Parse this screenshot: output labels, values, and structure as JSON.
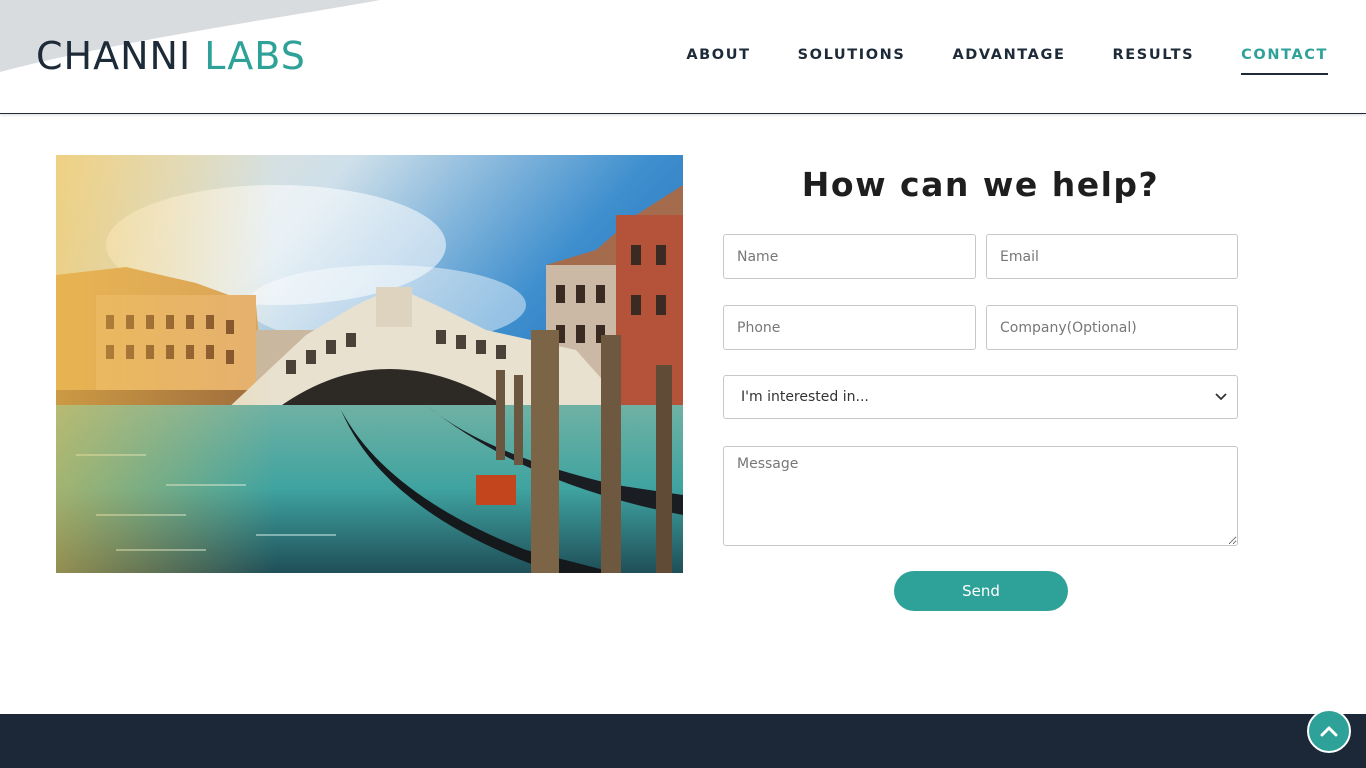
{
  "brand": {
    "logo_part1": "CHANNI",
    "logo_part2": "LABS",
    "dark_color": "#1d2a38",
    "accent_color": "#2ea199"
  },
  "nav": {
    "items": [
      {
        "label": "ABOUT",
        "active": false
      },
      {
        "label": "SOLUTIONS",
        "active": false
      },
      {
        "label": "ADVANTAGE",
        "active": false
      },
      {
        "label": "RESULTS",
        "active": false
      },
      {
        "label": "CONTACT",
        "active": true
      }
    ]
  },
  "hero_image": {
    "subject": "venice-rialto-bridge-gondolas"
  },
  "form": {
    "title": "How can we help?",
    "name_placeholder": "Name",
    "email_placeholder": "Email",
    "phone_placeholder": "Phone",
    "company_placeholder": "Company(Optional)",
    "interest_selected": "I'm interested in...",
    "message_placeholder": "Message",
    "send_label": "Send"
  },
  "footer": {
    "back_to_top_icon": "chevron-up-icon"
  }
}
